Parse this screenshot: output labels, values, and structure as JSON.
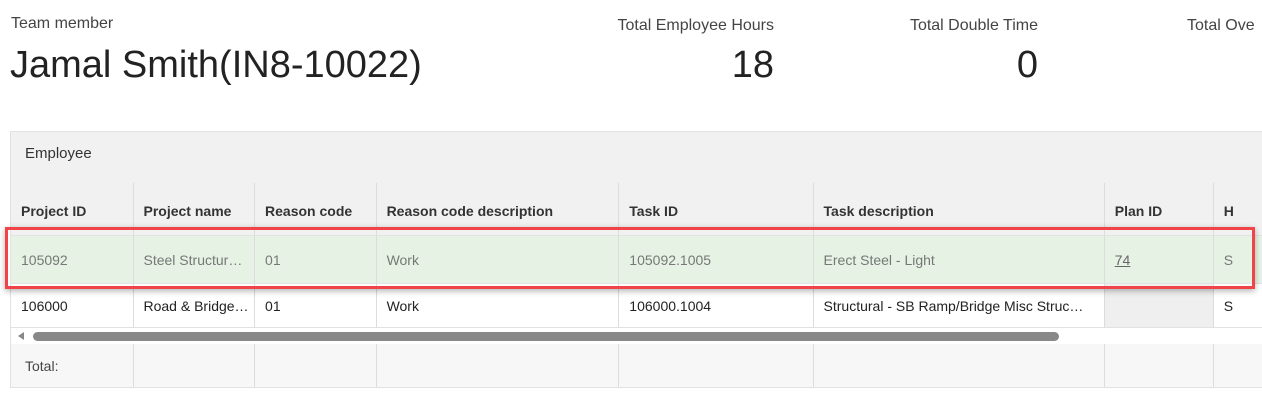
{
  "header": {
    "team_member_label": "Team member",
    "team_member_name": "Jamal Smith(IN8-10022)",
    "stats": [
      {
        "label": "Total Employee Hours",
        "value": "18"
      },
      {
        "label": "Total Double Time",
        "value": "0"
      },
      {
        "label": "Total Ove",
        "value": ""
      }
    ]
  },
  "grid": {
    "group_label": "Employee",
    "columns": [
      "Project ID",
      "Project name",
      "Reason code",
      "Reason code description",
      "Task ID",
      "Task description",
      "Plan ID",
      "H"
    ],
    "rows": [
      [
        "105092",
        "Steel Structur…",
        "01",
        "Work",
        "105092.1005",
        "Erect Steel - Light",
        "74",
        "S"
      ],
      [
        "106000",
        "Road & Bridge…",
        "01",
        "Work",
        "106000.1004",
        "Structural - SB Ramp/Bridge Misc Struc…",
        "",
        "S"
      ]
    ],
    "total_label": "Total:"
  },
  "colors": {
    "selected_row": "#e6f3e4",
    "highlight": "#f04448"
  }
}
